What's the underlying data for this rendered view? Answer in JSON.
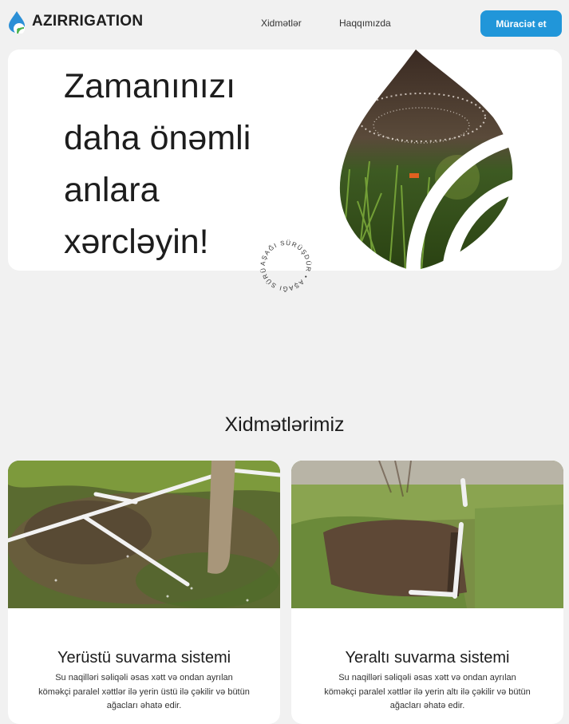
{
  "header": {
    "brand": "AZIRRIGATION",
    "nav": [
      {
        "label": "Xidmətlər"
      },
      {
        "label": "Haqqımızda"
      }
    ],
    "cta_label": "Müraciət et"
  },
  "hero": {
    "title_lines": [
      "Zamanınızı",
      "daha önəmli",
      "anlara",
      "xərcləyin!"
    ],
    "scroll_text": "AŞAĞI SÜRÜŞDÜR • AŞAĞI SÜRÜŞDÜR •"
  },
  "services": {
    "title": "Xidmətlərimiz",
    "items": [
      {
        "title": "Yerüstü suvarma sistemi",
        "description": "Su naqilləri səliqəli əsas xətt və ondan ayrılan köməkçi paralel xəttlər ilə yerin üstü ilə çəkilir və bütün ağacları əhatə edir."
      },
      {
        "title": "Yeraltı suvarma sistemi",
        "description": "Su naqilləri səliqəli əsas xətt və ondan ayrılan köməkçi paralel xəttlər ilə yerin altı ilə çəkilir və bütün ağacları əhatə edir."
      }
    ]
  },
  "colors": {
    "accent": "#2196d9",
    "logo_green": "#4bb24b",
    "background": "#f1f1f1"
  }
}
